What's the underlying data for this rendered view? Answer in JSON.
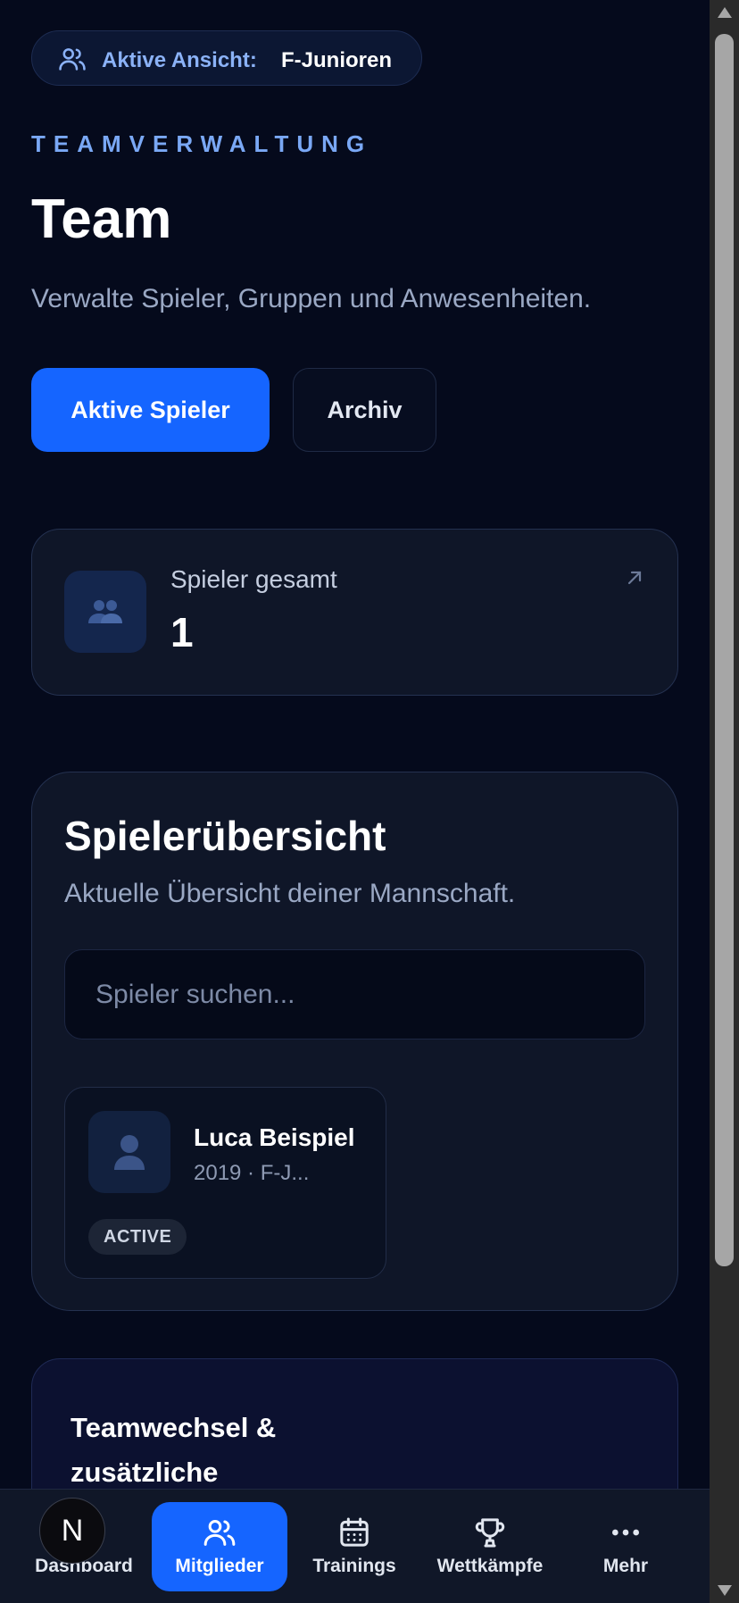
{
  "active_view": {
    "label": "Aktive Ansicht:",
    "value": "F-Junioren"
  },
  "header": {
    "eyebrow": "TEAMVERWALTUNG",
    "title": "Team",
    "subtitle": "Verwalte Spieler, Gruppen und Anwesenheiten."
  },
  "tabs": [
    {
      "label": "Aktive Spieler",
      "active": true
    },
    {
      "label": "Archiv",
      "active": false
    }
  ],
  "stats": {
    "label": "Spieler gesamt",
    "value": "1"
  },
  "overview": {
    "title": "Spielerübersicht",
    "subtitle": "Aktuelle Übersicht deiner Mannschaft.",
    "search_placeholder": "Spieler suchen...",
    "players": [
      {
        "name": "Luca Beispiel",
        "meta": "2019 · F-J...",
        "status": "ACTIVE"
      }
    ]
  },
  "team_change": {
    "title": "Teamwechsel & zusätzliche"
  },
  "nav": {
    "user_initial": "N",
    "items": [
      {
        "label": "Dashboard",
        "icon": "dashboard-icon"
      },
      {
        "label": "Mitglieder",
        "icon": "members-icon",
        "active": true
      },
      {
        "label": "Trainings",
        "icon": "calendar-icon"
      },
      {
        "label": "Wettkämpfe",
        "icon": "trophy-icon"
      },
      {
        "label": "Mehr",
        "icon": "more-icon"
      }
    ]
  },
  "colors": {
    "background": "#050a1c",
    "accent": "#1565ff",
    "eyebrow": "#7aa8f5",
    "card": "#0f1628"
  }
}
